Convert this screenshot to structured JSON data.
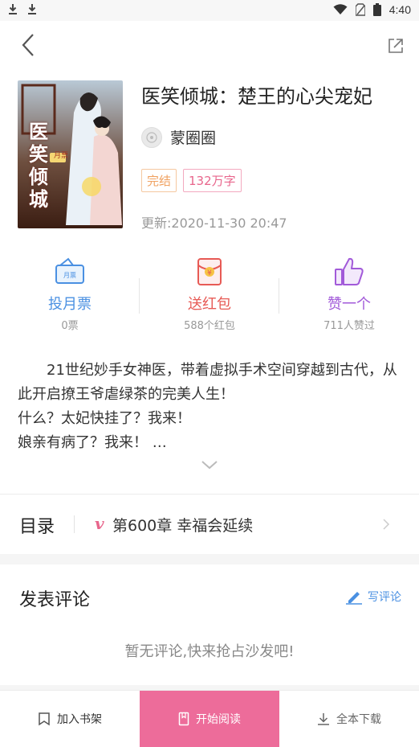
{
  "status_bar": {
    "time": "4:40"
  },
  "book": {
    "title": "医笑倾城：楚王的心尖宠妃",
    "author": "蒙圈圈",
    "tags": [
      "完结",
      "132万字"
    ],
    "update": "更新:2020-11-30 20:47",
    "cover_text": "医笑倾城",
    "cover_badge": "月票"
  },
  "actions": [
    {
      "label": "投月票",
      "sub": "0票",
      "color": "#4a90e2"
    },
    {
      "label": "送红包",
      "sub": "588个红包",
      "color": "#e75a55"
    },
    {
      "label": "赞一个",
      "sub": "711人赞过",
      "color": "#a25ad9"
    }
  ],
  "intro": {
    "line1": "21世纪妙手女神医，带着虚拟手术空间穿越到古代，从此开启撩王爷虐绿茶的完美人生！",
    "line2": "什么？太妃快挂了？我来！",
    "line3": "娘亲有病了？我来！ …"
  },
  "toc": {
    "title": "目录",
    "vip": "v",
    "chapter": "第600章 幸福会延续"
  },
  "comments": {
    "title": "发表评论",
    "write": "写评论",
    "empty": "暂无评论,快来抢占沙发吧!"
  },
  "bottom": {
    "add_shelf": "加入书架",
    "start_read": "开始阅读",
    "download_all": "全本下载"
  }
}
